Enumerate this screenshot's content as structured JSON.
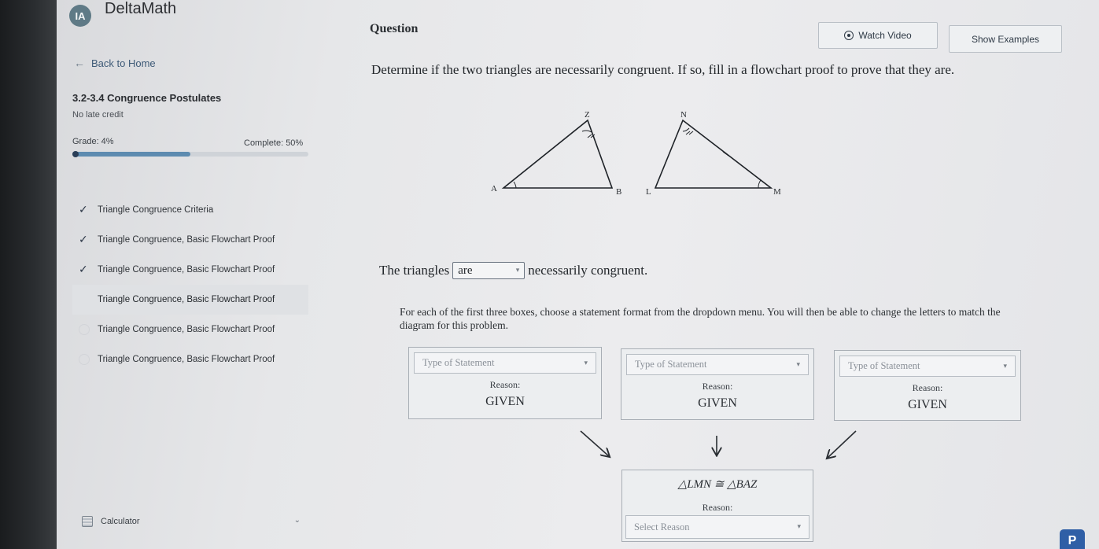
{
  "brand": {
    "logo_text": "ΙΑ",
    "name": "DeltaMath"
  },
  "sidebar": {
    "back_label": "Back to Home",
    "unit_title": "3.2-3.4 Congruence Postulates",
    "late_credit": "No late credit",
    "grade": "Grade: 4%",
    "complete": "Complete: 50%",
    "progress_fraction": 0.5,
    "items": [
      {
        "label": "Triangle Congruence Criteria",
        "status": "done"
      },
      {
        "label": "Triangle Congruence, Basic Flowchart Proof",
        "status": "done"
      },
      {
        "label": "Triangle Congruence, Basic Flowchart Proof",
        "status": "done"
      },
      {
        "label": "Triangle Congruence, Basic Flowchart Proof",
        "status": "active"
      },
      {
        "label": "Triangle Congruence, Basic Flowchart Proof",
        "status": "todo"
      },
      {
        "label": "Triangle Congruence, Basic Flowchart Proof",
        "status": "todo"
      }
    ],
    "calculator_label": "Calculator"
  },
  "main": {
    "question_label": "Question",
    "watch_video_label": "Watch Video",
    "show_examples_label": "Show Examples",
    "prompt": "Determine if the two triangles are necessarily congruent. If so, fill in a flowchart proof to prove that they are.",
    "diagram": {
      "triangle1": {
        "vertices": [
          "A",
          "B",
          "Z"
        ]
      },
      "triangle2": {
        "vertices": [
          "L",
          "M",
          "N"
        ]
      }
    },
    "congruent": {
      "prefix": "The triangles",
      "selected": "are",
      "suffix": "necessarily congruent."
    },
    "instructions": "For each of the first three boxes, choose a statement format from the dropdown menu. You will then be able to change the letters to match the diagram for this problem.",
    "boxes": [
      {
        "placeholder": "Type of Statement",
        "reason_label": "Reason:",
        "reason": "GIVEN"
      },
      {
        "placeholder": "Type of Statement",
        "reason_label": "Reason:",
        "reason": "GIVEN"
      },
      {
        "placeholder": "Type of Statement",
        "reason_label": "Reason:",
        "reason": "GIVEN"
      }
    ],
    "result": {
      "statement": "△LMN ≅ △BAZ",
      "reason_label": "Reason:",
      "placeholder": "Select Reason"
    }
  },
  "corner_badge": "P",
  "colors": {
    "progress": "#5d8bb0",
    "accent_badge": "#2f5fa6"
  }
}
